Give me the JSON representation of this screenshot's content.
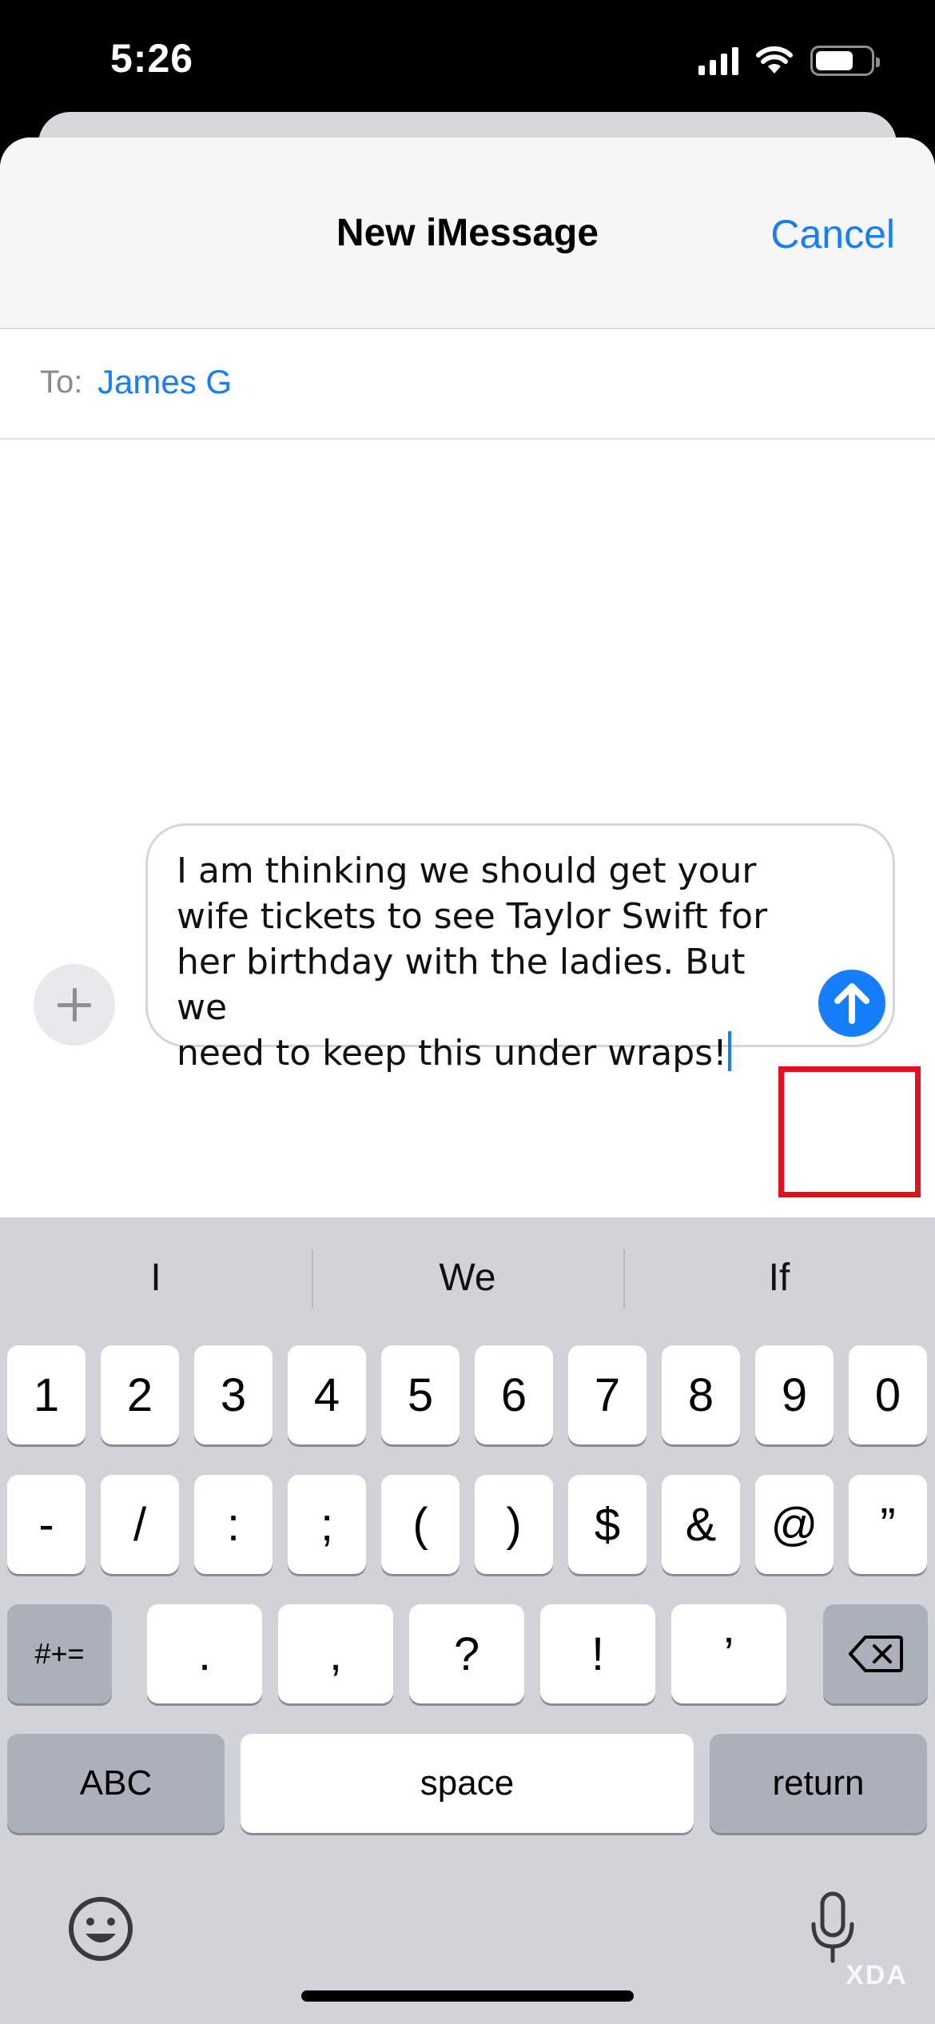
{
  "status_bar": {
    "time": "5:26"
  },
  "header": {
    "title": "New iMessage",
    "cancel_label": "Cancel"
  },
  "recipient": {
    "label": "To:",
    "name": "James G"
  },
  "compose": {
    "lines": [
      "I am thinking we should get your",
      "wife tickets to see Taylor Swift for",
      "her birthday with the ladies. But we",
      "need to keep this under wraps!"
    ]
  },
  "keyboard": {
    "suggestions": [
      "I",
      "We",
      "If"
    ],
    "row1": [
      "1",
      "2",
      "3",
      "4",
      "5",
      "6",
      "7",
      "8",
      "9",
      "0"
    ],
    "row2": [
      "-",
      "/",
      ":",
      ";",
      "(",
      ")",
      "$",
      "&",
      "@",
      "”"
    ],
    "row3": {
      "symbols_label": "#+=",
      "keys": [
        ".",
        ",",
        "?",
        "!",
        "’"
      ]
    },
    "row4": {
      "abc_label": "ABC",
      "space_label": "space",
      "return_label": "return"
    }
  },
  "watermark": "XDA",
  "colors": {
    "accent": "#147efb",
    "highlight": "#e5101d",
    "keyboard_bg": "#d1d3d9"
  }
}
